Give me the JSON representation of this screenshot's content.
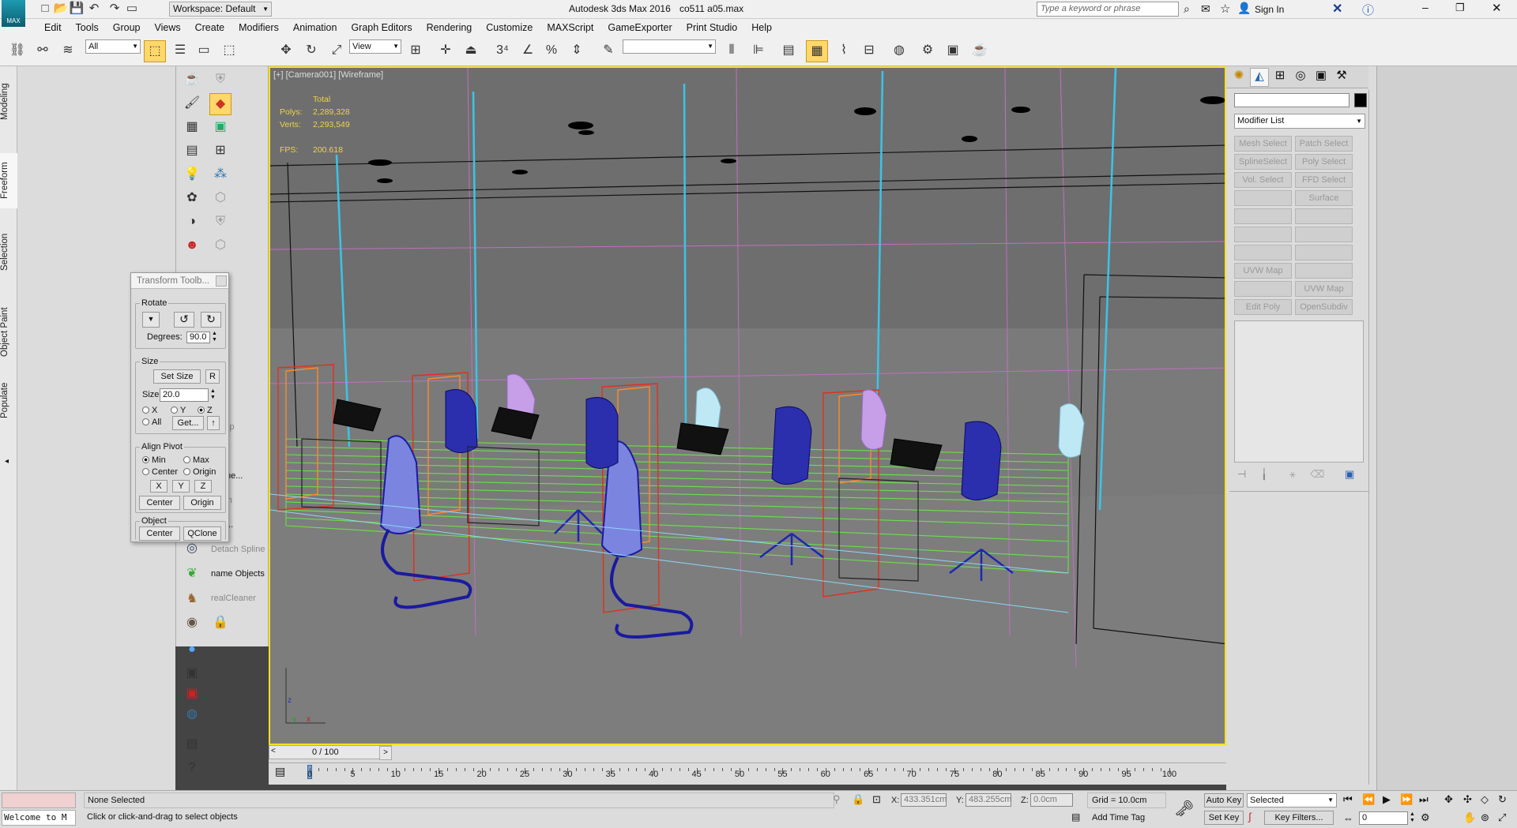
{
  "titlebar": {
    "app_logo": "MAX",
    "workspace": "Workspace: Default",
    "title": "Autodesk 3ds Max 2016",
    "filename": "co511 a05.max",
    "search_placeholder": "Type a keyword or phrase",
    "sign_in": "Sign In"
  },
  "menu": [
    "Edit",
    "Tools",
    "Group",
    "Views",
    "Create",
    "Modifiers",
    "Animation",
    "Graph Editors",
    "Rendering",
    "Customize",
    "MAXScript",
    "GameExporter",
    "Print Studio",
    "Help"
  ],
  "toolbar": {
    "selection_filter": "All",
    "ref_coord": "View",
    "named_selection": ""
  },
  "ribbon_tabs": [
    "Modeling",
    "Freeform",
    "Selection",
    "Object Paint",
    "Populate"
  ],
  "cmd_labels": [
    "ft Loop",
    "Scene...",
    "etach",
    "port...",
    "Detach Spline",
    "name Objects",
    "realCleaner"
  ],
  "transform_toolbox": {
    "title": "Transform Toolb...",
    "rotate_label": "Rotate",
    "degrees_label": "Degrees:",
    "degrees_value": "90.0",
    "size_label": "Size",
    "set_size": "Set Size",
    "r_button": "R",
    "size_field_label": "Size",
    "size_value": "20.0",
    "axis_x": "X",
    "axis_y": "Y",
    "axis_z": "Z",
    "axis_all": "All",
    "get_button": "Get...",
    "align_pivot_label": "Align Pivot",
    "min": "Min",
    "max": "Max",
    "center": "Center",
    "origin": "Origin",
    "x_btn": "X",
    "y_btn": "Y",
    "z_btn": "Z",
    "center_btn": "Center",
    "origin_btn": "Origin",
    "object_label": "Object",
    "obj_center": "Center",
    "qclone": "QClone"
  },
  "viewport": {
    "label": "[+] [Camera001] [Wireframe]",
    "stats_total": "Total",
    "polys_label": "Polys:",
    "polys_value": "2,289,328",
    "verts_label": "Verts:",
    "verts_value": "2,293,549",
    "fps_label": "FPS:",
    "fps_value": "200.618"
  },
  "modify_panel": {
    "name_field": "",
    "modifier_list": "Modifier List",
    "buttons": [
      "Mesh Select",
      "Patch Select",
      "SplineSelect",
      "Poly Select",
      "Vol. Select",
      "FFD Select",
      "",
      "Surface Select",
      "",
      "",
      "",
      "",
      "",
      "",
      "UVW Map",
      "",
      "",
      "UVW Map",
      "Edit Poly",
      "OpenSubdiv"
    ]
  },
  "timeline": {
    "frame_counter": "0 / 100",
    "ticks": [
      "0",
      "5",
      "10",
      "15",
      "20",
      "25",
      "30",
      "35",
      "40",
      "45",
      "50",
      "55",
      "60",
      "65",
      "70",
      "75",
      "80",
      "85",
      "90",
      "95",
      "100"
    ]
  },
  "status": {
    "maxscript_listener": "Welcome to M",
    "selection": "None Selected",
    "prompt": "Click or click-and-drag to select objects",
    "x_label": "X:",
    "x_value": "433.351cm",
    "y_label": "Y:",
    "y_value": "483.255cm",
    "z_label": "Z:",
    "z_value": "0.0cm",
    "grid": "Grid = 10.0cm",
    "add_time_tag": "Add Time Tag",
    "auto_key": "Auto Key",
    "set_key": "Set Key",
    "selected_dropdown": "Selected",
    "key_filters": "Key Filters...",
    "current_frame": "0"
  }
}
